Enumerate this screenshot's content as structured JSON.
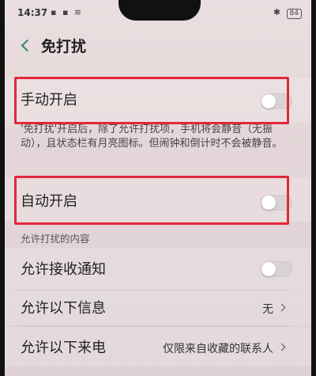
{
  "status_bar": {
    "time": "14:37",
    "left_icons": "▪ ▪ ≋",
    "right_icons": "✱",
    "battery": "84"
  },
  "nav": {
    "title": "免打扰"
  },
  "rows": {
    "manual": {
      "label": "手动开启",
      "enabled": false
    },
    "auto": {
      "label": "自动开启",
      "enabled": false
    },
    "allow_notifications": {
      "label": "允许接收通知",
      "enabled": false
    },
    "allow_messages": {
      "label": "允许以下信息",
      "value": "无"
    },
    "allow_calls": {
      "label": "允许以下来电",
      "value": "仅限来自收藏的联系人"
    }
  },
  "description": "'免打扰'开启后，除了允许打扰项，手机将会静音（无振动），且状态栏有月亮图标。但闹钟和倒计时不会被静音。",
  "section_header": "允许打扰的内容",
  "colors": {
    "highlight": "#e3273a",
    "accent": "#2a8a6c"
  }
}
